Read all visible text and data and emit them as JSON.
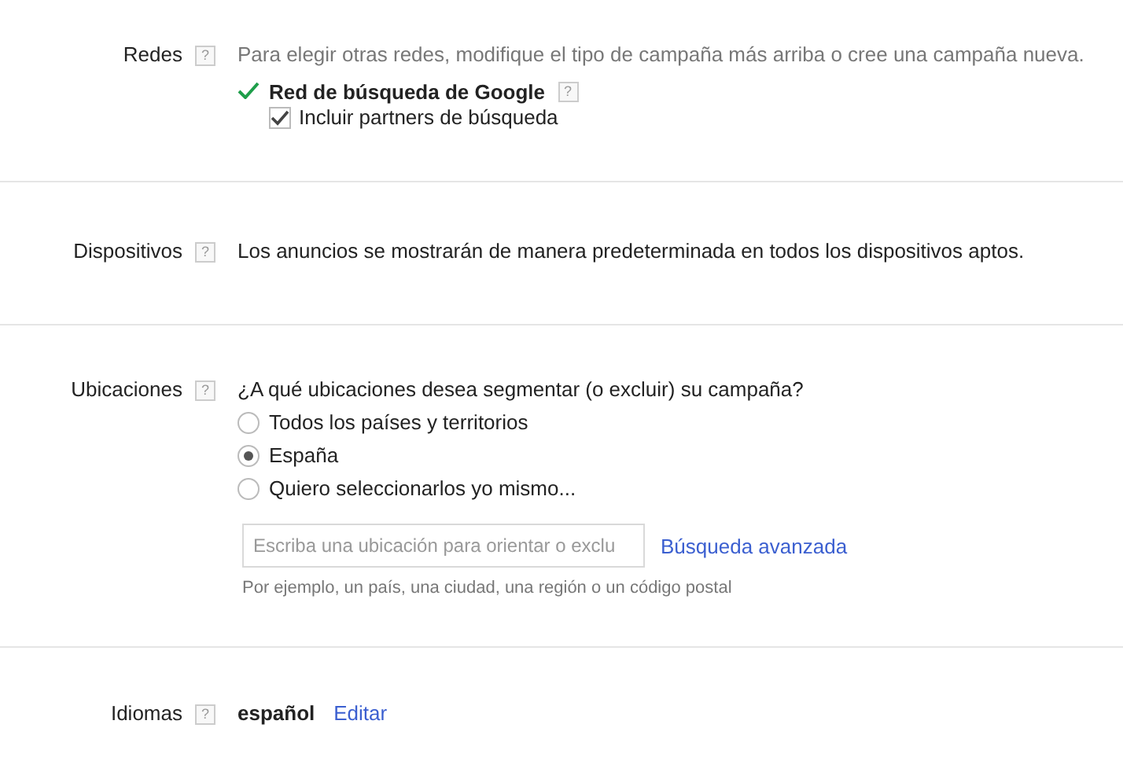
{
  "sections": [
    {
      "kind": "networks",
      "label": "Redes",
      "help": "?",
      "description": "Para elegir otras redes, modifique el tipo de campaña más arriba o cree una campaña nueva.",
      "network": {
        "name": "Red de búsqueda de Google",
        "help": "?",
        "enabled": true
      },
      "partners": {
        "label": "Incluir partners de búsqueda",
        "checked": true
      }
    },
    {
      "kind": "devices",
      "label": "Dispositivos",
      "help": "?",
      "description": "Los anuncios se mostrarán de manera predeterminada en todos los dispositivos aptos."
    },
    {
      "kind": "locations",
      "label": "Ubicaciones",
      "help": "?",
      "question": "¿A qué ubicaciones desea segmentar (o excluir) su campaña?",
      "options": [
        {
          "label": "Todos los países y territorios",
          "selected": false
        },
        {
          "label": "España",
          "selected": true
        },
        {
          "label": "Quiero seleccionarlos yo mismo...",
          "selected": false
        }
      ],
      "search": {
        "placeholder": "Escriba una ubicación para orientar o exclu"
      },
      "advanced_link": "Búsqueda avanzada",
      "hint": "Por ejemplo, un país, una ciudad, una región o un código postal"
    },
    {
      "kind": "languages",
      "label": "Idiomas",
      "help": "?",
      "value": "español",
      "edit_link": "Editar"
    }
  ]
}
